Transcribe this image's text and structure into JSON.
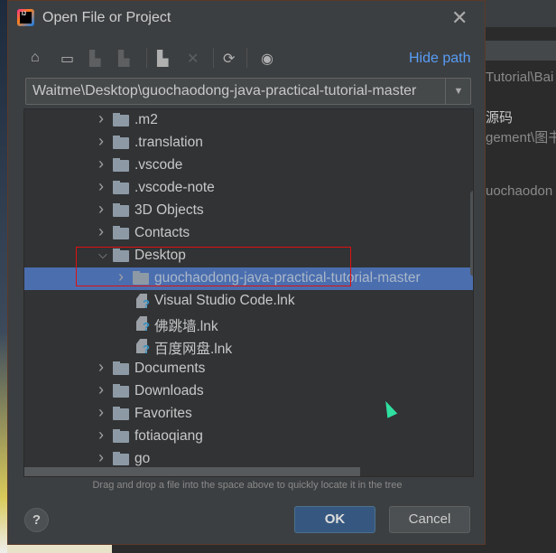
{
  "background_window": {
    "lines": [
      "Tutorial\\Bai",
      "源码",
      "gement\\图书",
      "uochaodon"
    ]
  },
  "dialog": {
    "title": "Open File or Project",
    "toolbar": {
      "icons": [
        "home-icon",
        "desktop-icon",
        "project-folder-icon",
        "module-folder-icon",
        "new-folder-icon",
        "delete-icon",
        "refresh-icon",
        "show-hidden-icon"
      ],
      "hide_path": "Hide path"
    },
    "path": "Waitme\\Desktop\\guochaodong-java-practical-tutorial-master",
    "tree": [
      {
        "label": ".m2",
        "level": 1,
        "type": "folder",
        "expanded": false
      },
      {
        "label": ".translation",
        "level": 1,
        "type": "folder",
        "expanded": false
      },
      {
        "label": ".vscode",
        "level": 1,
        "type": "folder",
        "expanded": false
      },
      {
        "label": ".vscode-note",
        "level": 1,
        "type": "folder",
        "expanded": false
      },
      {
        "label": "3D Objects",
        "level": 1,
        "type": "folder",
        "expanded": false
      },
      {
        "label": "Contacts",
        "level": 1,
        "type": "folder",
        "expanded": false
      },
      {
        "label": "Desktop",
        "level": 1,
        "type": "folder",
        "expanded": true
      },
      {
        "label": "guochaodong-java-practical-tutorial-master",
        "level": 2,
        "type": "folder",
        "expanded": false,
        "selected": true
      },
      {
        "label": "Visual Studio Code.lnk",
        "level": 2,
        "type": "file"
      },
      {
        "label": "佛跳墙.lnk",
        "level": 2,
        "type": "file"
      },
      {
        "label": "百度网盘.lnk",
        "level": 2,
        "type": "file"
      },
      {
        "label": "Documents",
        "level": 1,
        "type": "folder",
        "expanded": false
      },
      {
        "label": "Downloads",
        "level": 1,
        "type": "folder",
        "expanded": false
      },
      {
        "label": "Favorites",
        "level": 1,
        "type": "folder",
        "expanded": false
      },
      {
        "label": "fotiaoqiang",
        "level": 1,
        "type": "folder",
        "expanded": false
      },
      {
        "label": "go",
        "level": 1,
        "type": "folder",
        "expanded": false
      }
    ],
    "hint": "Drag and drop a file into the space above to quickly locate it in the tree",
    "help": "?",
    "ok": "OK",
    "cancel": "Cancel"
  }
}
